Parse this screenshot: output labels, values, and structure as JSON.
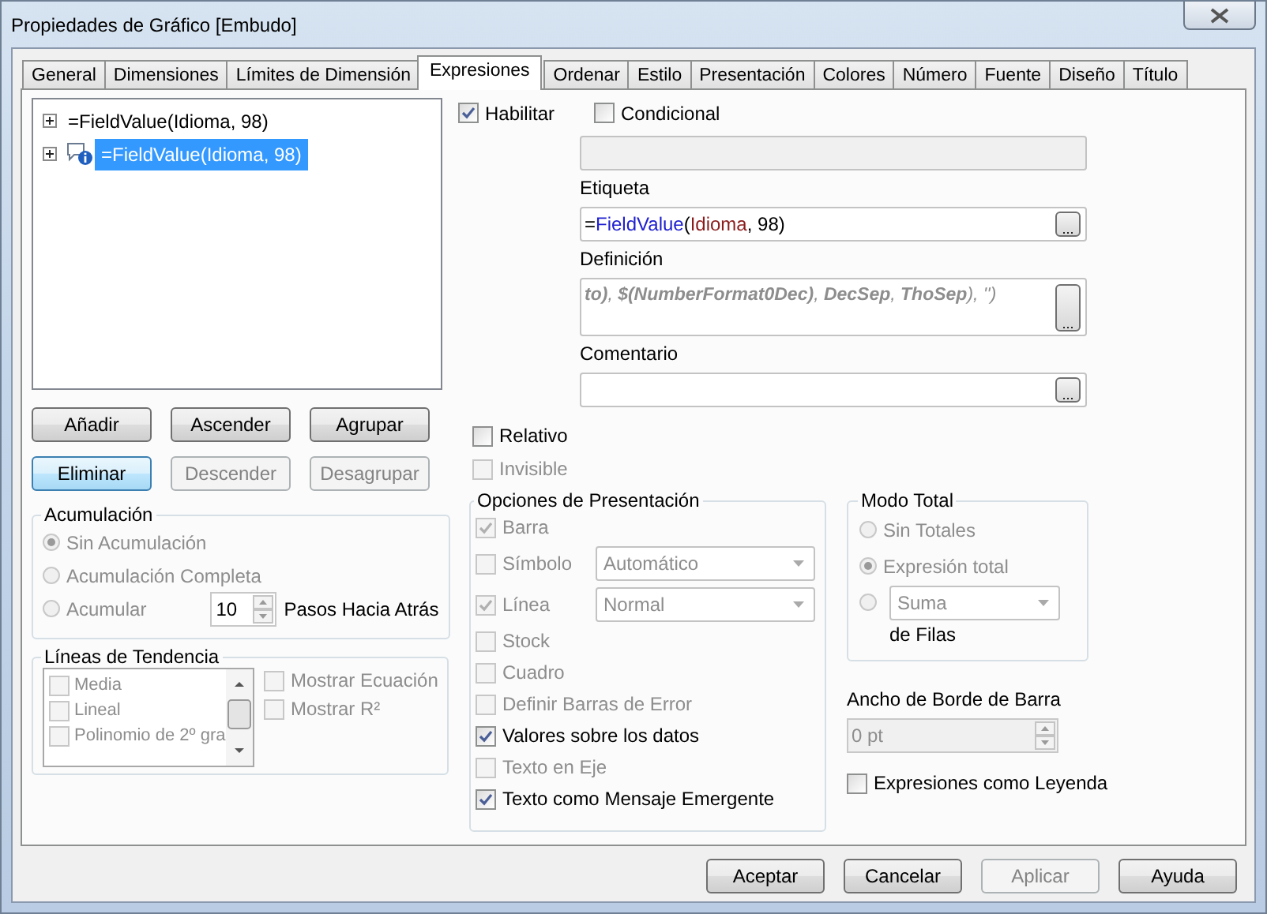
{
  "window": {
    "title": "Propiedades de Gráfico [Embudo]"
  },
  "tabs": [
    {
      "label": "General",
      "selected": false
    },
    {
      "label": "Dimensiones",
      "selected": false
    },
    {
      "label": "Límites de Dimensión",
      "selected": false
    },
    {
      "label": "Expresiones",
      "selected": true
    },
    {
      "label": "Ordenar",
      "selected": false
    },
    {
      "label": "Estilo",
      "selected": false
    },
    {
      "label": "Presentación",
      "selected": false
    },
    {
      "label": "Colores",
      "selected": false
    },
    {
      "label": "Número",
      "selected": false
    },
    {
      "label": "Fuente",
      "selected": false
    },
    {
      "label": "Diseño",
      "selected": false
    },
    {
      "label": "Título",
      "selected": false
    }
  ],
  "expressions": [
    {
      "label": "=FieldValue(Idioma, 98)",
      "kind": "plain",
      "expanded": false,
      "selected": false
    },
    {
      "label": "=FieldValue(Idioma, 98)",
      "kind": "annotated",
      "expanded": false,
      "selected": true
    }
  ],
  "list_buttons": [
    {
      "label": "Añadir",
      "disabled": false,
      "focused": false
    },
    {
      "label": "Ascender",
      "disabled": false,
      "focused": false
    },
    {
      "label": "Agrupar",
      "disabled": false,
      "focused": false
    },
    {
      "label": "Eliminar",
      "disabled": false,
      "focused": true
    },
    {
      "label": "Descender",
      "disabled": true,
      "focused": false
    },
    {
      "label": "Desagrupar",
      "disabled": true,
      "focused": false
    }
  ],
  "enable": {
    "label": "Habilitar",
    "checked": true
  },
  "conditional": {
    "label": "Condicional",
    "checked": false
  },
  "label_field": {
    "label": "Etiqueta",
    "button": "...",
    "tokens": [
      {
        "text": "=",
        "color": "#000000"
      },
      {
        "text": "FieldValue",
        "color": "#2020d0"
      },
      {
        "text": "(",
        "color": "#000000"
      },
      {
        "text": "Idioma",
        "color": "#8b1c1c"
      },
      {
        "text": ", 98)",
        "color": "#000000"
      }
    ]
  },
  "definition_field": {
    "label": "Definición",
    "button": "...",
    "value": "**to)**, **$(NumberFormat0Dec)**, **DecSep**, **ThoSep**), '')"
  },
  "comment_field": {
    "label": "Comentario",
    "button": "..."
  },
  "relative": {
    "label": "Relativo",
    "checked": false,
    "disabled": false
  },
  "invisible": {
    "label": "Invisible",
    "checked": false,
    "disabled": true
  },
  "accumulation": {
    "title": "Acumulación",
    "steps": "10",
    "steps_label": "Pasos Hacia Atrás",
    "options": [
      {
        "kind": "radio",
        "label": "Sin Acumulación",
        "selected": true,
        "disabled": true
      },
      {
        "kind": "radio",
        "label": "Acumulación Completa",
        "selected": false,
        "disabled": true
      },
      {
        "kind": "radio_steps",
        "label": "Acumular",
        "selected": false,
        "disabled": true
      }
    ]
  },
  "trendlines": {
    "title": "Líneas de Tendencia",
    "items": [
      {
        "label": "Media",
        "checked": false
      },
      {
        "label": "Lineal",
        "checked": false
      },
      {
        "label": "Polinomio de 2º gra",
        "checked": false
      }
    ],
    "options": [
      {
        "label": "Mostrar Ecuación",
        "checked": false,
        "disabled": true
      },
      {
        "label": "Mostrar R²",
        "checked": false,
        "disabled": true
      }
    ]
  },
  "display_options": {
    "title": "Opciones de Presentación",
    "items": [
      {
        "kind": "check",
        "label": "Barra",
        "checked": true,
        "disabled": true
      },
      {
        "kind": "check_select",
        "label": "Símbolo",
        "checked": false,
        "disabled": true,
        "select": "Automático"
      },
      {
        "kind": "check_select",
        "label": "Línea",
        "checked": true,
        "disabled": true,
        "select": "Normal"
      },
      {
        "kind": "check",
        "label": "Stock",
        "checked": false,
        "disabled": true
      },
      {
        "kind": "check",
        "label": "Cuadro",
        "checked": false,
        "disabled": true
      },
      {
        "kind": "check",
        "label": "Definir Barras de Error",
        "checked": false,
        "disabled": true
      },
      {
        "kind": "check",
        "label": "Valores sobre los datos",
        "checked": true,
        "disabled": false
      },
      {
        "kind": "check",
        "label": "Texto en Eje",
        "checked": false,
        "disabled": true
      },
      {
        "kind": "check",
        "label": "Texto como Mensaje Emergente",
        "checked": true,
        "disabled": false
      }
    ]
  },
  "total_mode": {
    "title": "Modo Total",
    "options": [
      {
        "kind": "radio",
        "label": "Sin Totales",
        "selected": false,
        "disabled": true
      },
      {
        "kind": "radio",
        "label": "Expresión total",
        "selected": true,
        "disabled": true
      },
      {
        "kind": "radio_select",
        "select": "Suma",
        "suffix": "de Filas",
        "selected": false,
        "disabled": true
      }
    ]
  },
  "bar_border": {
    "label": "Ancho de Borde de Barra",
    "value": "0 pt"
  },
  "legend": {
    "label": "Expresiones como Leyenda",
    "checked": false
  },
  "footer_buttons": [
    {
      "label": "Aceptar",
      "disabled": false
    },
    {
      "label": "Cancelar",
      "disabled": false
    },
    {
      "label": "Aplicar",
      "disabled": true
    },
    {
      "label": "Ayuda",
      "disabled": false
    }
  ]
}
